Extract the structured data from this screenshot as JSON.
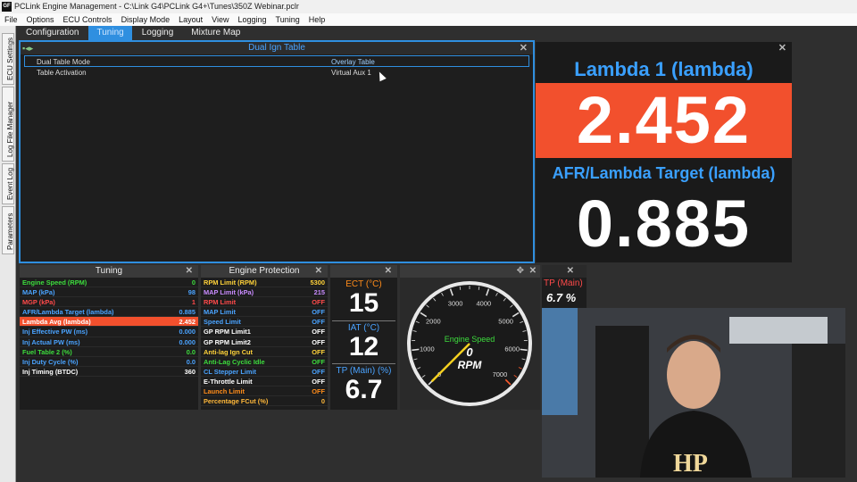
{
  "window": {
    "title": "PCLink Engine Management - C:\\Link G4\\PCLink G4+\\Tunes\\350Z Webinar.pclr",
    "icon": "GF"
  },
  "menu": [
    "File",
    "Options",
    "ECU Controls",
    "Display Mode",
    "Layout",
    "View",
    "Logging",
    "Tuning",
    "Help"
  ],
  "side_tabs": [
    "ECU Settings",
    "Log File Manager",
    "Event Log",
    "Parameters"
  ],
  "tabs": [
    {
      "label": "Configuration",
      "active": false
    },
    {
      "label": "Tuning",
      "active": true
    },
    {
      "label": "Logging",
      "active": false
    },
    {
      "label": "Mixture Map",
      "active": false
    }
  ],
  "dual_ign": {
    "title": "Dual Ign Table",
    "rows": [
      {
        "key": "Dual Table Mode",
        "value": "Overlay Table"
      },
      {
        "key": "Table Activation",
        "value": "Virtual Aux 1"
      }
    ]
  },
  "lambda_panel": {
    "title1": "Lambda 1 (lambda)",
    "value1": "2.452",
    "title2": "AFR/Lambda Target (lambda)",
    "value2": "0.885"
  },
  "tuning_panel": {
    "title": "Tuning",
    "rows": [
      {
        "key": "Engine Speed (RPM)",
        "value": "0",
        "color": "#3ddc3d"
      },
      {
        "key": "MAP (kPa)",
        "value": "98",
        "color": "#4aa3ff"
      },
      {
        "key": "MGP (kPa)",
        "value": "1",
        "color": "#ff4a4a"
      },
      {
        "key": "AFR/Lambda Target (lambda)",
        "value": "0.885",
        "color": "#4aa3ff"
      },
      {
        "key": "Lambda Avg (lambda)",
        "value": "2.452",
        "color": "#ffffff",
        "highlight": true
      },
      {
        "key": "Inj Effective PW (ms)",
        "value": "0.000",
        "color": "#4aa3ff"
      },
      {
        "key": "Inj Actual PW (ms)",
        "value": "0.000",
        "color": "#4aa3ff"
      },
      {
        "key": "Fuel Table 2 (%)",
        "value": "0.0",
        "color": "#3ddc3d"
      },
      {
        "key": "Inj Duty Cycle (%)",
        "value": "0.0",
        "color": "#4aa3ff"
      },
      {
        "key": "Inj Timing (BTDC)",
        "value": "360",
        "color": "#ffffff"
      }
    ]
  },
  "protection_panel": {
    "title": "Engine Protection",
    "rows": [
      {
        "key": "RPM Limit (RPM)",
        "value": "5300",
        "color": "#ffd23a"
      },
      {
        "key": "MAP Limit (kPa)",
        "value": "215",
        "color": "#c98cff"
      },
      {
        "key": "RPM Limit",
        "value": "OFF",
        "color": "#ff4a4a"
      },
      {
        "key": "MAP Limit",
        "value": "OFF",
        "color": "#4aa3ff"
      },
      {
        "key": "Speed Limit",
        "value": "OFF",
        "color": "#4aa3ff"
      },
      {
        "key": "GP RPM Limit1",
        "value": "OFF",
        "color": "#ffffff"
      },
      {
        "key": "GP RPM Limit2",
        "value": "OFF",
        "color": "#ffffff"
      },
      {
        "key": "Anti-lag Ign Cut",
        "value": "OFF",
        "color": "#ffd23a"
      },
      {
        "key": "Anti-Lag Cyclic Idle",
        "value": "OFF",
        "color": "#3ddc3d"
      },
      {
        "key": "CL Stepper Limit",
        "value": "OFF",
        "color": "#4aa3ff"
      },
      {
        "key": "E-Throttle Limit",
        "value": "OFF",
        "color": "#ffffff"
      },
      {
        "key": "Launch Limit",
        "value": "OFF",
        "color": "#ff8c1a"
      },
      {
        "key": "Percentage FCut (%)",
        "value": "0",
        "color": "#ffb83a"
      }
    ]
  },
  "temps": {
    "ect_label": "ECT (°C)",
    "ect_value": "15",
    "iat_label": "IAT (°C)",
    "iat_value": "12",
    "tp_label": "TP (Main) (%)",
    "tp_value": "6.7"
  },
  "gauge": {
    "title": "Engine Speed",
    "value": "0",
    "unit": "RPM",
    "ticks": [
      "0",
      "1000",
      "2000",
      "3000",
      "4000",
      "5000",
      "6000",
      "7000"
    ],
    "current": 0
  },
  "tp_mini": {
    "label": "TP (Main)",
    "value": "6.7 %"
  },
  "webcam": {
    "shirt_text": "HP"
  },
  "colors": {
    "accent": "#2f8fe0",
    "highlight": "#f2502d",
    "title_blue": "#3aa0ff"
  }
}
